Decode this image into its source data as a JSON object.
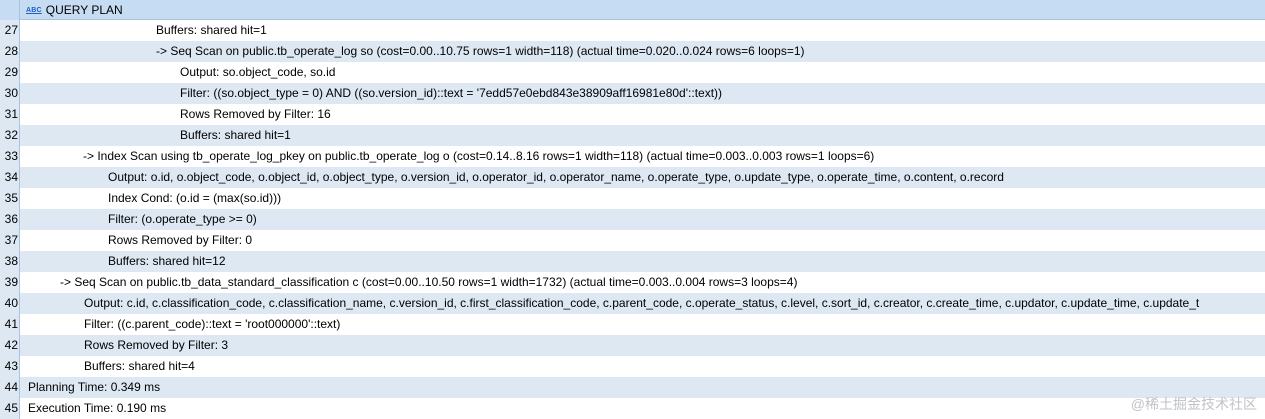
{
  "header": {
    "icon": "abc-text-icon",
    "icon_text": "ABC",
    "column_label": "QUERY PLAN"
  },
  "rows": [
    {
      "num": "27",
      "indent": 128,
      "text": "Buffers: shared hit=1"
    },
    {
      "num": "28",
      "indent": 128,
      "text": "->  Seq Scan on public.tb_operate_log so  (cost=0.00..10.75 rows=1 width=118) (actual time=0.020..0.024 rows=6 loops=1)"
    },
    {
      "num": "29",
      "indent": 152,
      "text": "Output: so.object_code, so.id"
    },
    {
      "num": "30",
      "indent": 152,
      "text": "Filter: ((so.object_type = 0) AND ((so.version_id)::text = '7edd57e0ebd843e38909aff16981e80d'::text))"
    },
    {
      "num": "31",
      "indent": 152,
      "text": "Rows Removed by Filter: 16"
    },
    {
      "num": "32",
      "indent": 152,
      "text": "Buffers: shared hit=1"
    },
    {
      "num": "33",
      "indent": 55,
      "text": "->  Index Scan using tb_operate_log_pkey on public.tb_operate_log o  (cost=0.14..8.16 rows=1 width=118) (actual time=0.003..0.003 rows=1 loops=6)"
    },
    {
      "num": "34",
      "indent": 80,
      "text": "Output: o.id, o.object_code, o.object_id, o.object_type, o.version_id, o.operator_id, o.operator_name, o.operate_type, o.update_type, o.operate_time, o.content, o.record"
    },
    {
      "num": "35",
      "indent": 80,
      "text": "Index Cond: (o.id = (max(so.id)))"
    },
    {
      "num": "36",
      "indent": 80,
      "text": "Filter: (o.operate_type >= 0)"
    },
    {
      "num": "37",
      "indent": 80,
      "text": "Rows Removed by Filter: 0"
    },
    {
      "num": "38",
      "indent": 80,
      "text": "Buffers: shared hit=12"
    },
    {
      "num": "39",
      "indent": 32,
      "text": "->  Seq Scan on public.tb_data_standard_classification c  (cost=0.00..10.50 rows=1 width=1732) (actual time=0.003..0.004 rows=3 loops=4)"
    },
    {
      "num": "40",
      "indent": 56,
      "text": "Output: c.id, c.classification_code, c.classification_name, c.version_id, c.first_classification_code, c.parent_code, c.operate_status, c.level, c.sort_id, c.creator, c.create_time, c.updator, c.update_time, c.update_t"
    },
    {
      "num": "41",
      "indent": 56,
      "text": "Filter: ((c.parent_code)::text = 'root000000'::text)"
    },
    {
      "num": "42",
      "indent": 56,
      "text": "Rows Removed by Filter: 3"
    },
    {
      "num": "43",
      "indent": 56,
      "text": "Buffers: shared hit=4"
    },
    {
      "num": "44",
      "indent": 0,
      "text": "Planning Time: 0.349 ms"
    },
    {
      "num": "45",
      "indent": 0,
      "text": "Execution Time: 0.190 ms"
    }
  ],
  "watermark": "@稀土掘金技术社区"
}
